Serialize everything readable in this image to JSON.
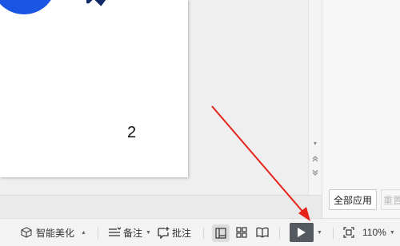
{
  "slide": {
    "page_number": "2"
  },
  "right_panel": {
    "apply_all_label": "全部应用",
    "reset_label": "重置"
  },
  "statusbar": {
    "beautify_label": "智能美化",
    "notes_label": "备注",
    "comments_label": "批注",
    "zoom_label": "110%"
  },
  "icons": {
    "beautify": "cube-icon",
    "notes": "notes-icon",
    "comments": "comment-plus-icon",
    "normal_view": "normal-view-icon",
    "sorter_view": "grid-view-icon",
    "reading_view": "book-icon",
    "play": "play-icon",
    "fit": "fit-window-icon"
  },
  "colors": {
    "accent_blue": "#1a55e3",
    "play_button": "#555a61",
    "annotation_arrow": "#e5231b"
  }
}
